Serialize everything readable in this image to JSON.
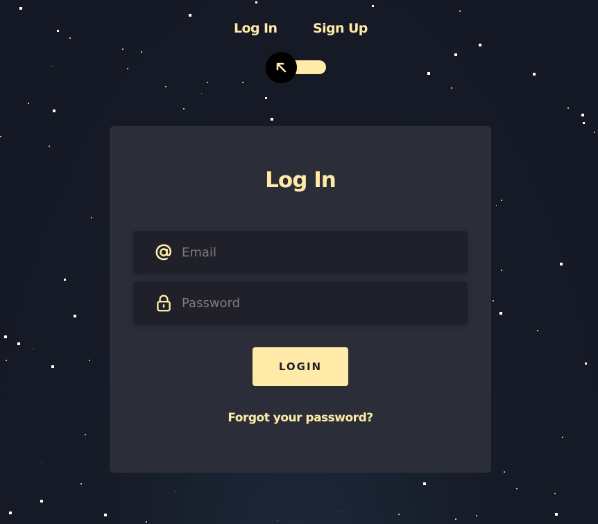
{
  "nav": {
    "login_tab": "Log In",
    "signup_tab": "Sign Up"
  },
  "toggle": {
    "state": "login",
    "icon": "arrow-up-left-icon"
  },
  "form": {
    "title": "Log In",
    "email": {
      "placeholder": "Email",
      "value": "",
      "icon": "at-sign-icon"
    },
    "password": {
      "placeholder": "Password",
      "value": "",
      "icon": "lock-icon"
    },
    "submit_label": "LOGIN",
    "forgot_label": "Forgot your password?"
  },
  "colors": {
    "accent": "#ffeba7",
    "background": "#161b28",
    "card": "#2b2e38",
    "field": "#1f2029",
    "button_text": "#1f2029"
  }
}
